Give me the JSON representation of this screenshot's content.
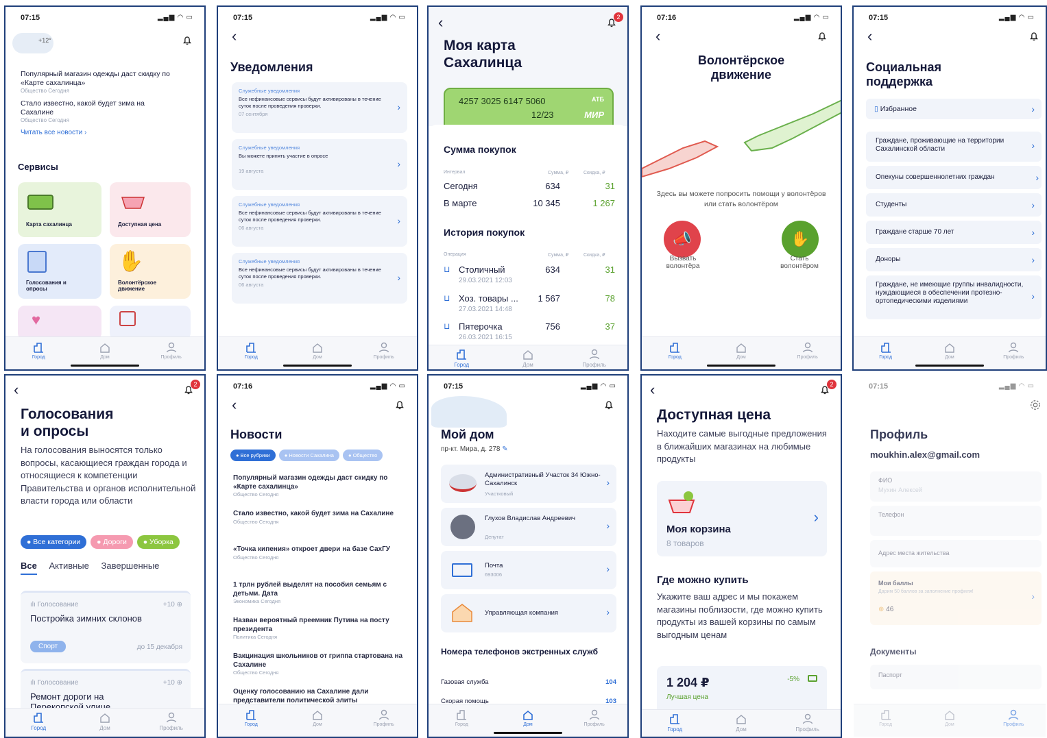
{
  "tabs": {
    "city": "Город",
    "home": "Дом",
    "profile": "Профиль"
  },
  "s1": {
    "time": "07:15",
    "temp": "+12°",
    "news": [
      {
        "title": "Популярный магазин одежды даст скидку по «Карте сахалинца»",
        "meta": "Общество  Сегодня"
      },
      {
        "title": "Стало известно, какой будет зима на Сахалине",
        "meta": "Общество  Сегодня"
      }
    ],
    "read_all": "Читать все новости ›",
    "services_title": "Сервисы",
    "services": [
      "Карта сахалинца",
      "Доступная цена",
      "Голосования и опросы",
      "Волонтёрское движение"
    ]
  },
  "s2": {
    "time": "07:15",
    "title": "Уведомления",
    "items": [
      {
        "type": "Служебные уведомления",
        "text": "Все нефинансовые сервисы будут активированы в течение суток после проведения проверки.",
        "date": "07 сентября"
      },
      {
        "type": "Служебные уведомления",
        "text": "Вы можете принять участие в опросе",
        "date": "19 августа"
      },
      {
        "type": "Служебные уведомления",
        "text": "Все нефинансовые сервисы будут активированы в течение суток после проведения проверки.",
        "date": "06 августа"
      },
      {
        "type": "Служебные уведомления",
        "text": "Все нефинансовые сервисы будут активированы в течение суток после проведения проверки.",
        "date": "06 августа"
      }
    ]
  },
  "s3": {
    "badge": "2",
    "title1": "Моя карта",
    "title2": "Сахалинца",
    "card_number": "4257 3025 6147 5060",
    "card_exp": "12/23",
    "card_bank": "АТБ",
    "card_system": "МИР",
    "sum_title": "Сумма покупок",
    "col_interval": "Интервал",
    "col_sum": "Сумма, ₽",
    "col_discount": "Скидка, ₽",
    "sums": [
      {
        "label": "Сегодня",
        "sum": "634",
        "disc": "31"
      },
      {
        "label": "В марте",
        "sum": "10 345",
        "disc": "1 267"
      }
    ],
    "hist_title": "История покупок",
    "col_op": "Операция",
    "history": [
      {
        "name": "Столичный",
        "date": "29.03.2021  12:03",
        "sum": "634",
        "disc": "31"
      },
      {
        "name": "Хоз. товары ...",
        "date": "27.03.2021  14:48",
        "sum": "1 567",
        "disc": "78"
      },
      {
        "name": "Пятерочка",
        "date": "26.03.2021  16:15",
        "sum": "756",
        "disc": "37"
      }
    ]
  },
  "s4": {
    "time": "07:16",
    "title1": "Волонтёрское",
    "title2": "движение",
    "desc": "Здесь вы можете попросить помощи у волонтёров или стать волонтёром",
    "call": "Вызвать волонтёра",
    "become": "Стать волонтёром"
  },
  "s5": {
    "time": "07:15",
    "title1": "Социальная",
    "title2": "поддержка",
    "fav": "Избранное",
    "items": [
      "Граждане, проживающие на территории Сахалинской области",
      "Опекуны совершеннолетних граждан",
      "Студенты",
      "Граждане старше 70 лет",
      "Доноры",
      "Граждане, не имеющие группы инвалидности, нуждающиеся в обеспечении протезно-ортопедическими изделиями"
    ]
  },
  "s6": {
    "badge": "2",
    "title1": "Голосования",
    "title2": "и опросы",
    "desc": "На голосования выносятся только вопросы, касающиеся граждан города и относящиеся к компетенции Правительства и органов исполнительной власти города или области",
    "chips": [
      "● Все категории",
      "● Дороги",
      "● Уборка"
    ],
    "filters": [
      "Все",
      "Активные",
      "Завершенные"
    ],
    "polls": [
      {
        "kind": "Голосование",
        "points": "+10",
        "title": "Постройка зимних склонов",
        "tag": "Спорт",
        "deadline": "до 15 декабря"
      },
      {
        "kind": "Голосование",
        "points": "+10",
        "title": "Ремонт дороги на Перекопской улице"
      }
    ]
  },
  "s7": {
    "time": "07:16",
    "title": "Новости",
    "chips": [
      "● Все рубрики",
      "● Новости Сахалина",
      "● Общество"
    ],
    "news": [
      {
        "title": "Популярный магазин одежды даст скидку по «Карте сахалинца»",
        "meta": "Общество  Сегодня"
      },
      {
        "title": "Стало известно, какой будет зима на Сахалине",
        "meta": "Общество  Сегодня"
      },
      {
        "title": "«Точка кипения» откроет двери на базе СахГУ",
        "meta": "Общество  Сегодня"
      },
      {
        "title": "1 трлн рублей выделят на пособия семьям с детьми. Дата",
        "meta": "Экономика  Сегодня"
      },
      {
        "title": "Назван вероятный преемник Путина на посту президента",
        "meta": "Политика  Сегодня"
      },
      {
        "title": "Вакцинация школьников от гриппа стартована на Сахалине",
        "meta": "Общество  Сегодня"
      },
      {
        "title": "Оценку голосованию на Сахалине дали представители политической элиты",
        "meta": ""
      }
    ]
  },
  "s8": {
    "time": "07:15",
    "title": "Мой дом",
    "address": "пр-кт. Мира, д. 278",
    "items": [
      {
        "title": "Административный Участок 34 Южно-Сахалинск",
        "sub": "Участковый"
      },
      {
        "title": "Глухов Владислав Андреевич",
        "sub": "Депутат"
      },
      {
        "title": "Почта",
        "sub": "693006"
      },
      {
        "title": "Управляющая компания",
        "sub": ""
      }
    ],
    "phones_title": "Номера телефонов экстренных служб",
    "phones": [
      {
        "name": "Газовая служба",
        "num": "104"
      },
      {
        "name": "Скорая помощь",
        "num": "103"
      }
    ]
  },
  "s9": {
    "badge": "2",
    "title": "Доступная цена",
    "desc": "Находите самые выгодные предложения в ближайших магазинах на любимые продукты",
    "basket": "Моя корзина",
    "basket_count": "8 товаров",
    "where_title": "Где можно купить",
    "where_desc": "Укажите ваш адрес и мы покажем магазины поблизости, где можно купить продукты из вашей корзины по самым выгодным ценам",
    "price": "1 204 ₽",
    "discount": "-5%",
    "best": "Лучшая цена"
  },
  "s10": {
    "time": "07:15",
    "title": "Профиль",
    "email": "moukhin.alex@gmail.com",
    "fio_label": "ФИО",
    "fio_value": "Мухин Алексей",
    "phone_label": "Телефон",
    "addr_label": "Адрес места жительства",
    "points_title": "Мои баллы",
    "points_desc": "Дарим 50 баллов за заполнение профиля!",
    "points": "46",
    "docs_title": "Документы",
    "passport": "Паспорт"
  }
}
